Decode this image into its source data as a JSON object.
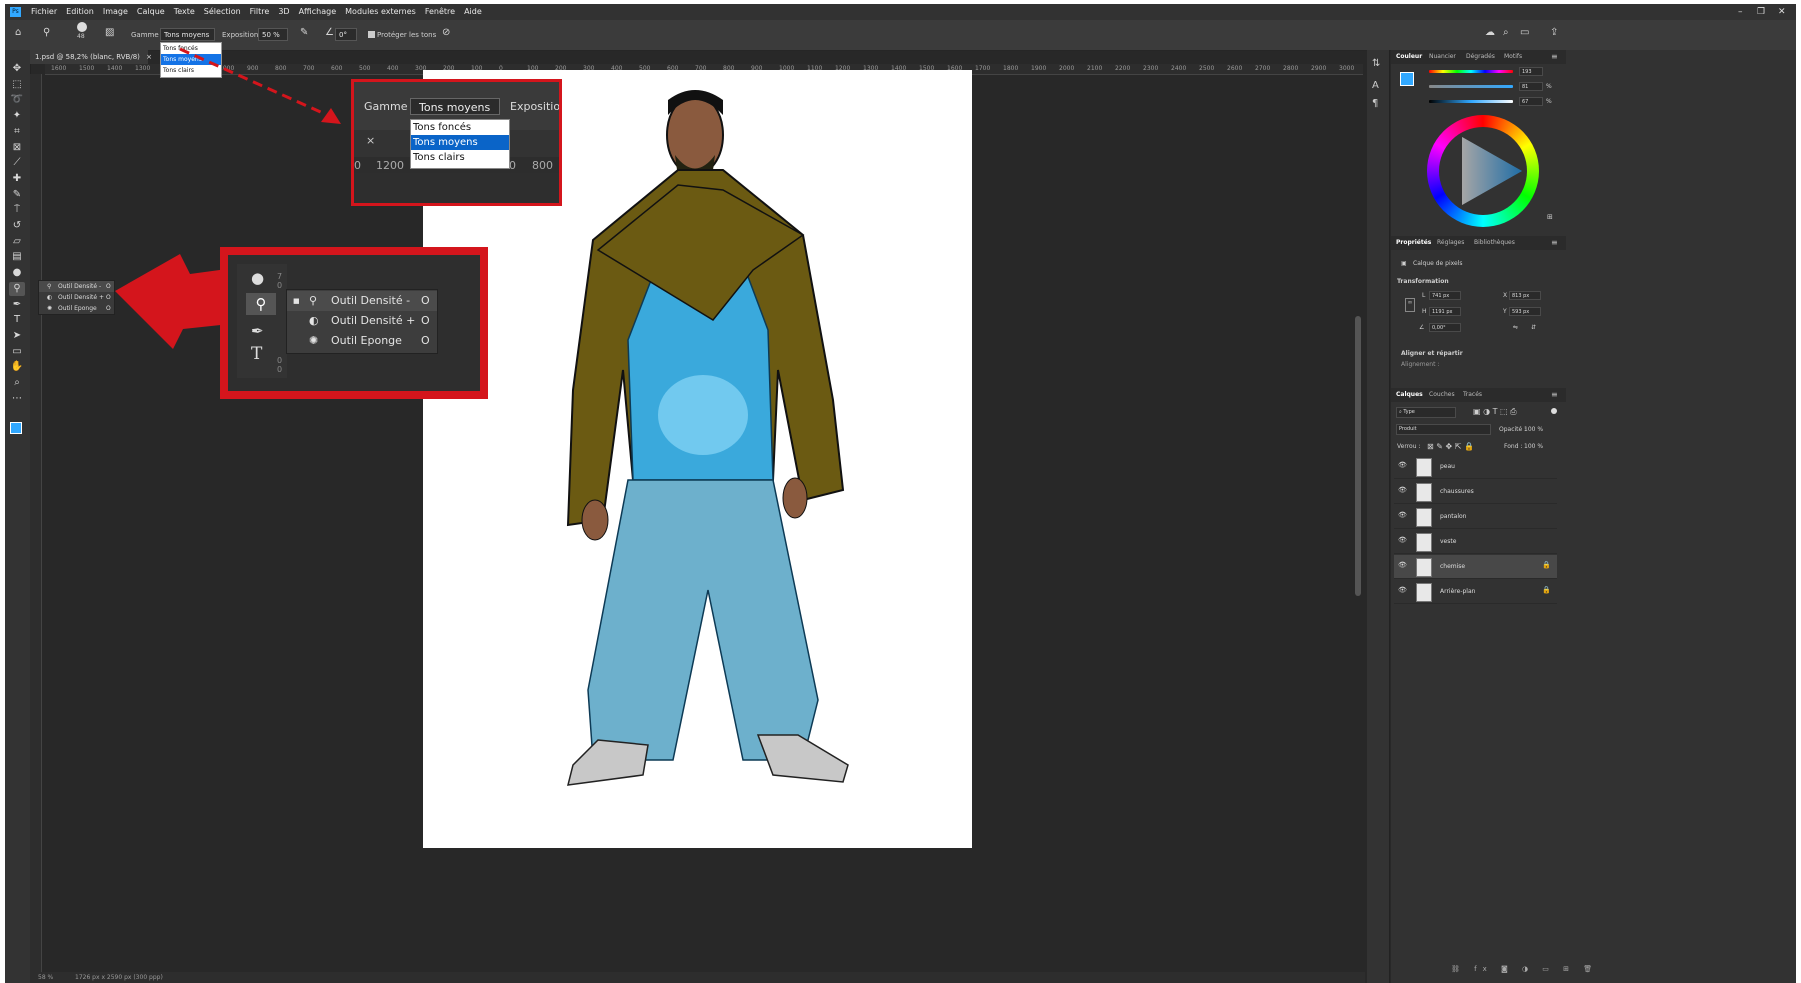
{
  "menubar": {
    "logo": "Ps",
    "menus": [
      "Fichier",
      "Edition",
      "Image",
      "Calque",
      "Texte",
      "Sélection",
      "Filtre",
      "3D",
      "Affichage",
      "Modules externes",
      "Fenêtre",
      "Aide"
    ],
    "window_controls": [
      "–",
      "❐",
      "✕"
    ]
  },
  "options": {
    "brush_size": "48",
    "gamme_label": "Gamme :",
    "gamme_value": "Tons moyens",
    "exposure_label": "Exposition :",
    "exposure_value": "50 %",
    "angle_value": "0°",
    "protect_label": "Protéger les tons",
    "range_options": [
      "Tons foncés",
      "Tons moyens",
      "Tons clairs"
    ]
  },
  "document_tab": {
    "title": "1.psd @ 58,2% (blanc, RVB/8)",
    "close": "×"
  },
  "ruler_top_labels": [
    "1600",
    "1500",
    "1400",
    "1300",
    "1200",
    "1100",
    "1000",
    "900",
    "800",
    "700",
    "600",
    "500",
    "400",
    "300",
    "200",
    "100",
    "0",
    "100",
    "200",
    "300",
    "400",
    "500",
    "600",
    "700",
    "800",
    "900",
    "1000",
    "1100",
    "1200",
    "1300",
    "1400",
    "1500",
    "1600",
    "1700",
    "1800",
    "1900",
    "2000",
    "2100",
    "2200",
    "2300",
    "2400",
    "2500",
    "2600",
    "2700",
    "2800",
    "2900",
    "3000"
  ],
  "toolbar_icons": [
    "move-icon",
    "marquee-icon",
    "lasso-icon",
    "magic-wand-icon",
    "crop-icon",
    "frame-icon",
    "eyedropper-icon",
    "healing-icon",
    "brush-icon",
    "stamp-icon",
    "history-brush-icon",
    "eraser-icon",
    "gradient-icon",
    "blur-icon",
    "dodge-icon",
    "pen-icon",
    "type-icon",
    "path-select-icon",
    "shape-icon",
    "hand-icon",
    "zoom-icon",
    "more-icon"
  ],
  "small_flyout": [
    {
      "label": "Outil Densité -",
      "key": "O"
    },
    {
      "label": "Outil Densité +",
      "key": "O"
    },
    {
      "label": "Outil Eponge",
      "key": "O"
    }
  ],
  "callout_top": {
    "gamme_label": "Gamme :",
    "gamme_value": "Tons moyens",
    "exposure_label": "Exposition",
    "options": [
      "Tons foncés",
      "Tons moyens",
      "Tons clairs"
    ],
    "ruler_labels": [
      "0",
      "1200",
      "0",
      "800"
    ],
    "close": "×"
  },
  "callout_mid": {
    "flyout": [
      {
        "label": "Outil Densité -",
        "key": "O"
      },
      {
        "label": "Outil Densité +",
        "key": "O"
      },
      {
        "label": "Outil Eponge",
        "key": "O"
      }
    ],
    "ruler_digits": [
      "7",
      "0",
      "0",
      "0"
    ]
  },
  "statusbar": {
    "zoom": "58 %",
    "size": "1726 px x 2590 px (300 ppp)"
  },
  "color_panel": {
    "tabs": [
      "Couleur",
      "Nuancier",
      "Dégradés",
      "Motifs"
    ],
    "values": [
      "193",
      "81",
      "67"
    ],
    "units": [
      "",
      "%",
      "%"
    ],
    "accent": "#31a8ff"
  },
  "properties_panel": {
    "tabs": [
      "Propriétés",
      "Réglages",
      "Bibliothèques"
    ],
    "pixel_layer_label": "Calque de pixels",
    "transform_label": "Transformation",
    "w_label": "L",
    "w_value": "741 px",
    "h_label": "H",
    "h_value": "1191 px",
    "x_label": "X",
    "x_value": "813 px",
    "y_label": "Y",
    "y_value": "593 px",
    "angle_value": "0,00°",
    "align_label": "Aligner et répartir",
    "align_sub": "Alignement :"
  },
  "layers_panel": {
    "tabs": [
      "Calques",
      "Couches",
      "Tracés"
    ],
    "search_label": "Type",
    "blend_mode": "Produit",
    "opacity_label": "Opacité :",
    "opacity_value": "100 %",
    "lock_label": "Verrou :",
    "fill_label": "Fond :",
    "fill_value": "100 %",
    "layers": [
      {
        "name": "peau",
        "locked": false,
        "selected": false
      },
      {
        "name": "chaussures",
        "locked": false,
        "selected": false
      },
      {
        "name": "pantalon",
        "locked": false,
        "selected": false
      },
      {
        "name": "veste",
        "locked": false,
        "selected": false
      },
      {
        "name": "chemise",
        "locked": true,
        "selected": true
      },
      {
        "name": "Arrière-plan",
        "locked": true,
        "selected": false
      }
    ]
  },
  "colors": {
    "jacket": "#6b5a12",
    "shirt": "#3aa9dc",
    "pants": "#6db0cc",
    "skin": "#8a5a3e",
    "shoes": "#c8c8c8",
    "callout_red": "#d4151c"
  }
}
